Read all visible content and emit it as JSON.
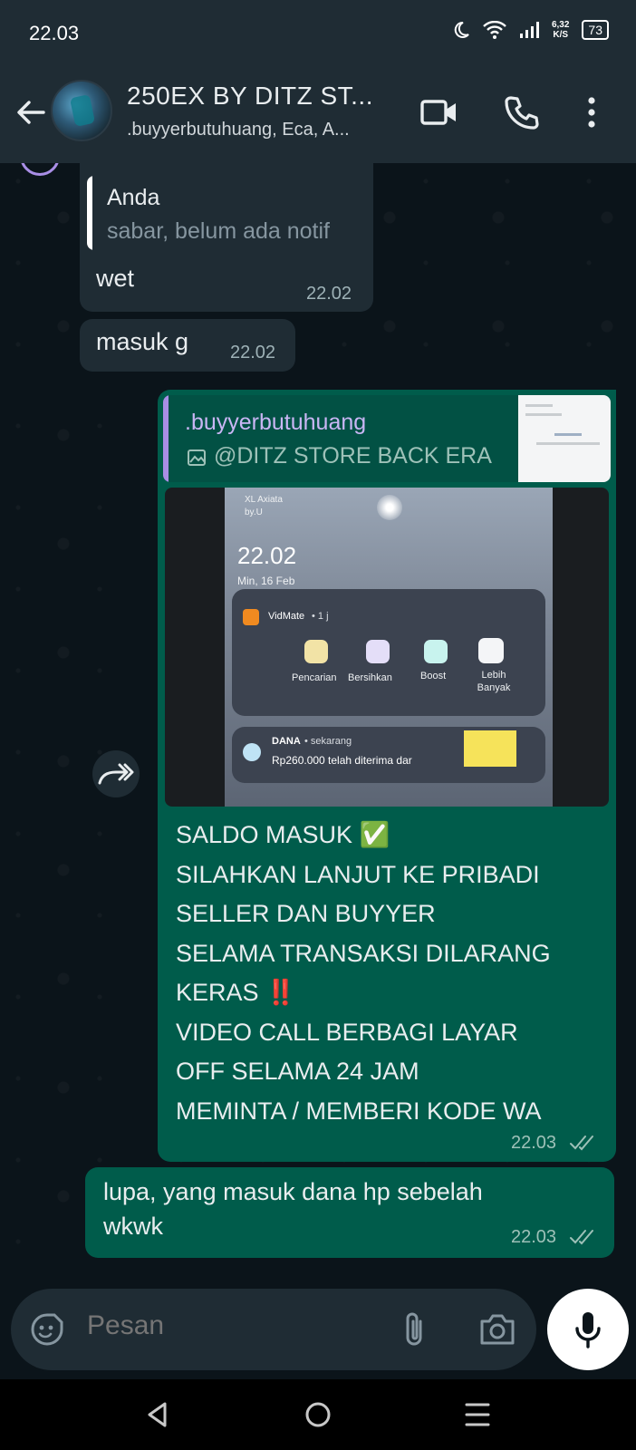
{
  "status_bar": {
    "time": "22.03",
    "net_speed_value": "6,32",
    "net_speed_unit": "K/S",
    "battery": "73"
  },
  "header": {
    "title": "250EX BY DITZ ST...",
    "subtitle": ".buyyerbutuhuang, Eca, A..."
  },
  "messages": [
    {
      "quote_author": "Anda",
      "quote_text": "sabar, belum ada notif",
      "text": "wet",
      "time": "22.02"
    },
    {
      "text": "masuk g",
      "time": "22.02"
    },
    {
      "quote_author": ".buyyerbutuhuang",
      "quote_text": "@DITZ STORE BACK ERA",
      "photo": {
        "carrier": "XL Axiata",
        "carrier_sub": "by.U",
        "time": "22.02",
        "date": "Min, 16 Feb",
        "app_name": "VidMate",
        "app_meta": "• 1 j",
        "actions": [
          "Pencarian",
          "Bersihkan",
          "Boost",
          "Lebih\nBanyak"
        ],
        "notif_app": "DANA",
        "notif_meta": "• sekarang",
        "notif_text": "Rp260.000 telah diterima dar"
      },
      "lines": [
        "SALDO MASUK ✅",
        "SILAHKAN LANJUT KE PRIBADI",
        "SELLER DAN BUYYER",
        "SELAMA TRANSAKSI DILARANG",
        "KERAS ‼️",
        "VIDEO CALL BERBAGI LAYAR",
        "OFF SELAMA 24 JAM",
        "MEMINTA / MEMBERI KODE WA"
      ],
      "time": "22.03"
    },
    {
      "lines": [
        "lupa, yang masuk dana hp sebelah",
        "wkwk"
      ],
      "time": "22.03"
    }
  ],
  "input": {
    "placeholder": "Pesan"
  },
  "colors": {
    "incoming": "#1f2c34",
    "outgoing": "#005c4b",
    "background": "#0b141a",
    "quote_self": "#ffffff",
    "quote_other": "#a98ee6"
  }
}
